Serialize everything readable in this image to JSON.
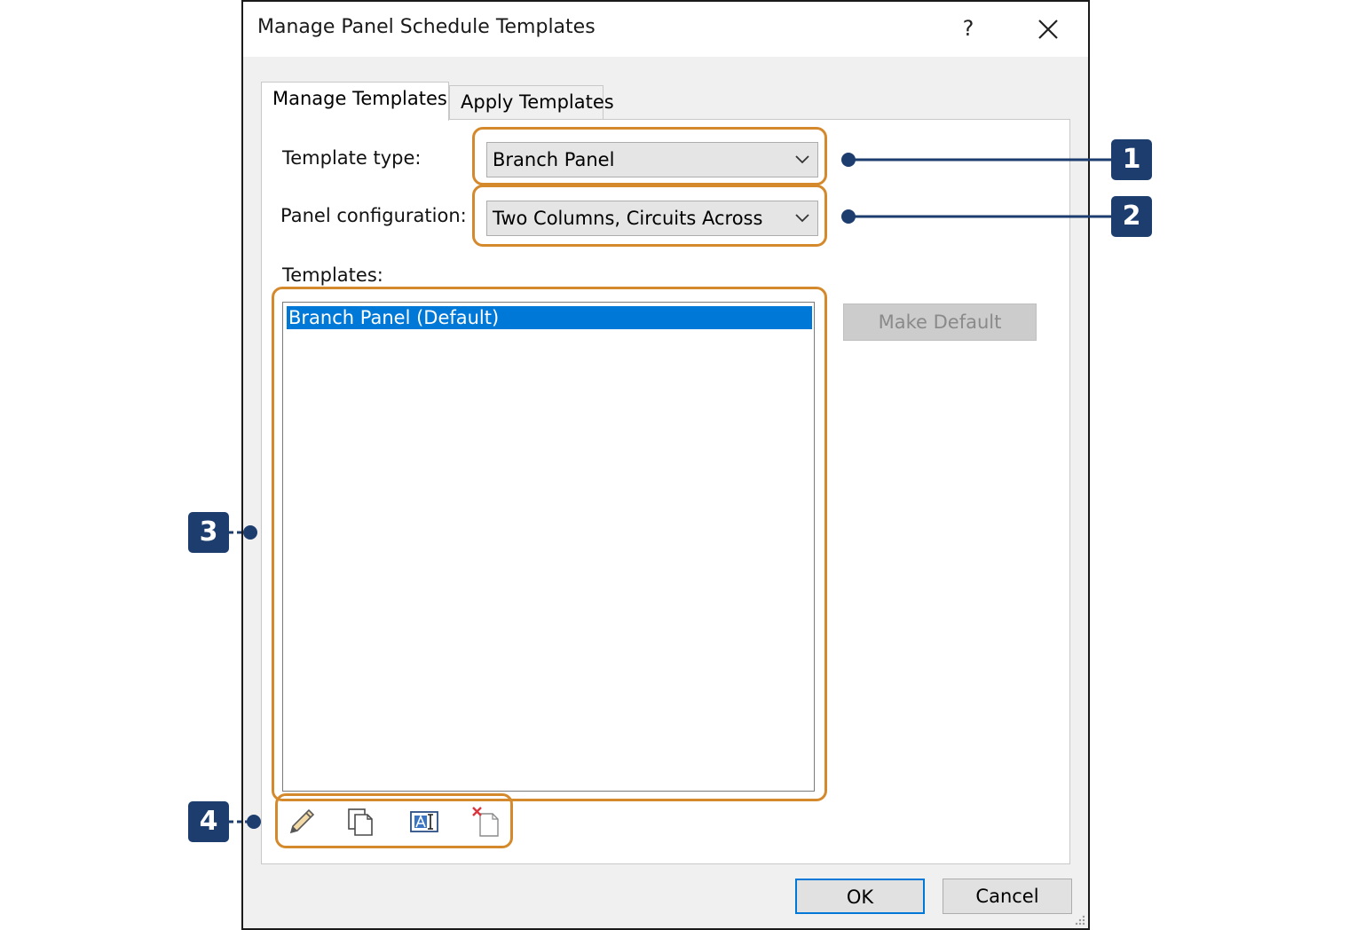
{
  "dialog": {
    "title": "Manage Panel Schedule Templates",
    "help_label": "?",
    "close_icon": "close-icon"
  },
  "tabs": [
    {
      "label": "Manage Templates",
      "active": true
    },
    {
      "label": "Apply Templates",
      "active": false
    }
  ],
  "form": {
    "template_type_label": "Template type:",
    "template_type_value": "Branch Panel",
    "panel_config_label": "Panel configuration:",
    "panel_config_value": "Two Columns, Circuits Across",
    "templates_label": "Templates:"
  },
  "templates": {
    "items": [
      "Branch Panel (Default)"
    ],
    "selected_index": 0
  },
  "buttons": {
    "make_default": "Make Default",
    "ok": "OK",
    "cancel": "Cancel"
  },
  "toolbar_icons": [
    "pencil-icon",
    "duplicate-icon",
    "rename-icon",
    "delete-icon"
  ],
  "callouts": [
    "1",
    "2",
    "3",
    "4"
  ],
  "colors": {
    "highlight": "#d48a2c",
    "badge": "#1c3d6e",
    "selection": "#0078d7"
  }
}
